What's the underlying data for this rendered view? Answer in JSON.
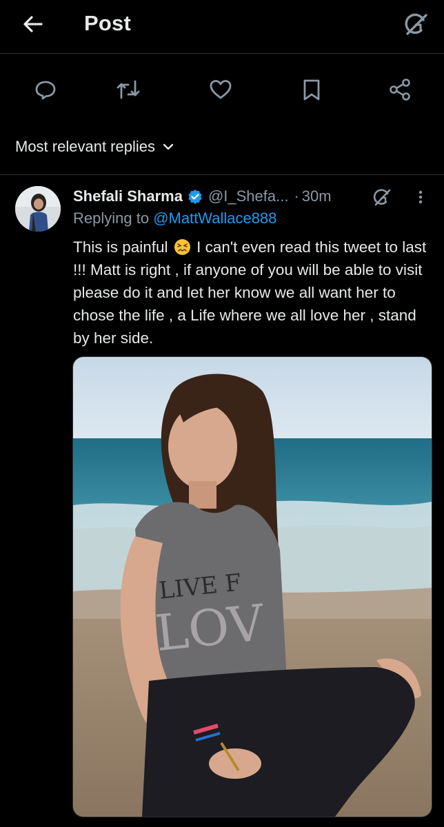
{
  "header": {
    "title": "Post"
  },
  "actions": [
    {
      "icon": "reply-icon"
    },
    {
      "icon": "repost-icon"
    },
    {
      "icon": "like-icon"
    },
    {
      "icon": "bookmark-icon"
    },
    {
      "icon": "share-icon"
    }
  ],
  "sort": {
    "label": "Most relevant replies"
  },
  "reply": {
    "author_name": "Shefali Sharma",
    "handle": "@I_Shefa...",
    "separator": "·",
    "time": "30m",
    "replying_prefix": "Replying to ",
    "replying_to": "@MattWallace888",
    "text_part1": "This is painful",
    "text_part2": " I can't even read this tweet to last !!! Matt is right , if anyone of you will be able to visit please do it and let her know we all want her to chose the life , a Life where we all love her , stand by her side."
  },
  "colors": {
    "background": "#000000",
    "text": "#e7e9ea",
    "muted": "#8b98a5",
    "link": "#1d9bf0",
    "divider": "#2f3336"
  }
}
